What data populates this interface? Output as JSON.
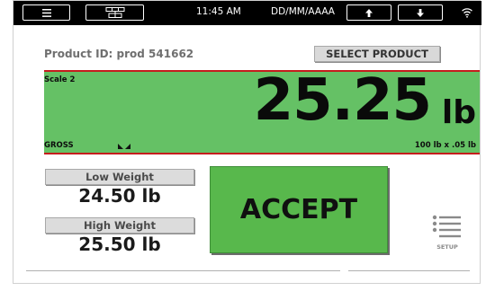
{
  "topbar": {
    "menu_icon": "hamburger-menu-icon",
    "network_icon": "network-icon",
    "time": "11:45 AM",
    "date": "DD/MM/AAAA",
    "up_icon": "arrow-up-icon",
    "down_icon": "arrow-down-icon",
    "wifi_icon": "wifi-icon"
  },
  "product": {
    "id_label": "Product ID: prod 541662",
    "select_button": "SELECT PRODUCT"
  },
  "scale": {
    "name": "Scale 2",
    "weight": "25.25",
    "unit": "lb",
    "mode": "GROSS",
    "capacity": "100 lb x .05 lb",
    "zero_icon": "center-of-zero-icon",
    "colors": {
      "panel": "#65c165",
      "border": "#c51d1d"
    }
  },
  "limits": {
    "low_label": "Low Weight",
    "low_value": "24.50 lb",
    "high_label": "High Weight",
    "high_value": "25.50 lb"
  },
  "accept": {
    "label": "ACCEPT",
    "color": "#58b84c"
  },
  "setup": {
    "label": "SETUP",
    "icon": "list-menu-icon"
  }
}
